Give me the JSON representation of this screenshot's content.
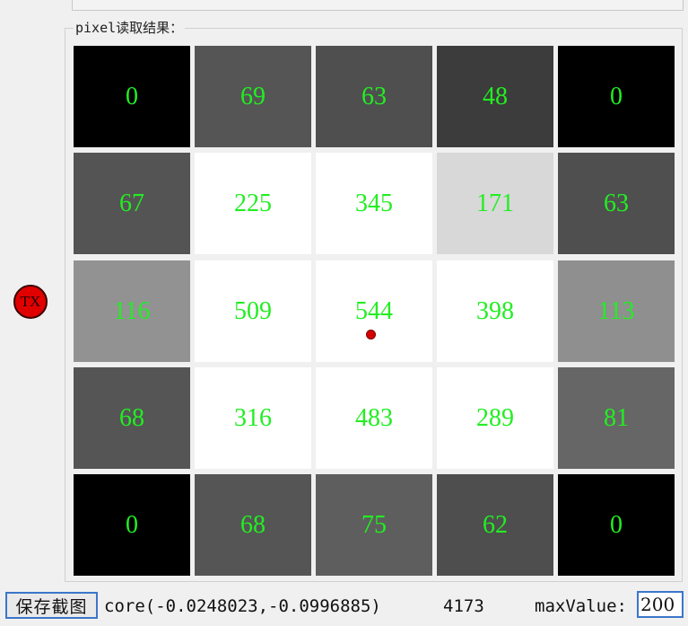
{
  "panel": {
    "title": "pixel读取结果："
  },
  "grid": {
    "rows": [
      [
        {
          "value": "0",
          "color": "#000000"
        },
        {
          "value": "69",
          "color": "#555555"
        },
        {
          "value": "63",
          "color": "#4f4f4f"
        },
        {
          "value": "48",
          "color": "#3c3c3c"
        },
        {
          "value": "0",
          "color": "#000000"
        }
      ],
      [
        {
          "value": "67",
          "color": "#545454"
        },
        {
          "value": "225",
          "color": "#ffffff"
        },
        {
          "value": "345",
          "color": "#ffffff"
        },
        {
          "value": "171",
          "color": "#d8d8d8"
        },
        {
          "value": "63",
          "color": "#4f4f4f"
        }
      ],
      [
        {
          "value": "116",
          "color": "#929292"
        },
        {
          "value": "509",
          "color": "#ffffff"
        },
        {
          "value": "544",
          "color": "#ffffff"
        },
        {
          "value": "398",
          "color": "#ffffff"
        },
        {
          "value": "113",
          "color": "#8f8f8f"
        }
      ],
      [
        {
          "value": "68",
          "color": "#555555"
        },
        {
          "value": "316",
          "color": "#ffffff"
        },
        {
          "value": "483",
          "color": "#ffffff"
        },
        {
          "value": "289",
          "color": "#ffffff"
        },
        {
          "value": "81",
          "color": "#666666"
        }
      ],
      [
        {
          "value": "0",
          "color": "#000000"
        },
        {
          "value": "68",
          "color": "#555555"
        },
        {
          "value": "75",
          "color": "#5e5e5e"
        },
        {
          "value": "62",
          "color": "#4e4e4e"
        },
        {
          "value": "0",
          "color": "#000000"
        }
      ]
    ]
  },
  "tx_marker": {
    "label": "TX"
  },
  "footer": {
    "save_label": "保存截图",
    "core_text": "core(-0.0248023,-0.0996885)",
    "sum_text": "4173",
    "max_label": "maxValue:",
    "max_value": "200"
  },
  "colors": {
    "value_text": "#22ee22",
    "marker": "#e00000",
    "focus_border": "#3b76c9"
  }
}
